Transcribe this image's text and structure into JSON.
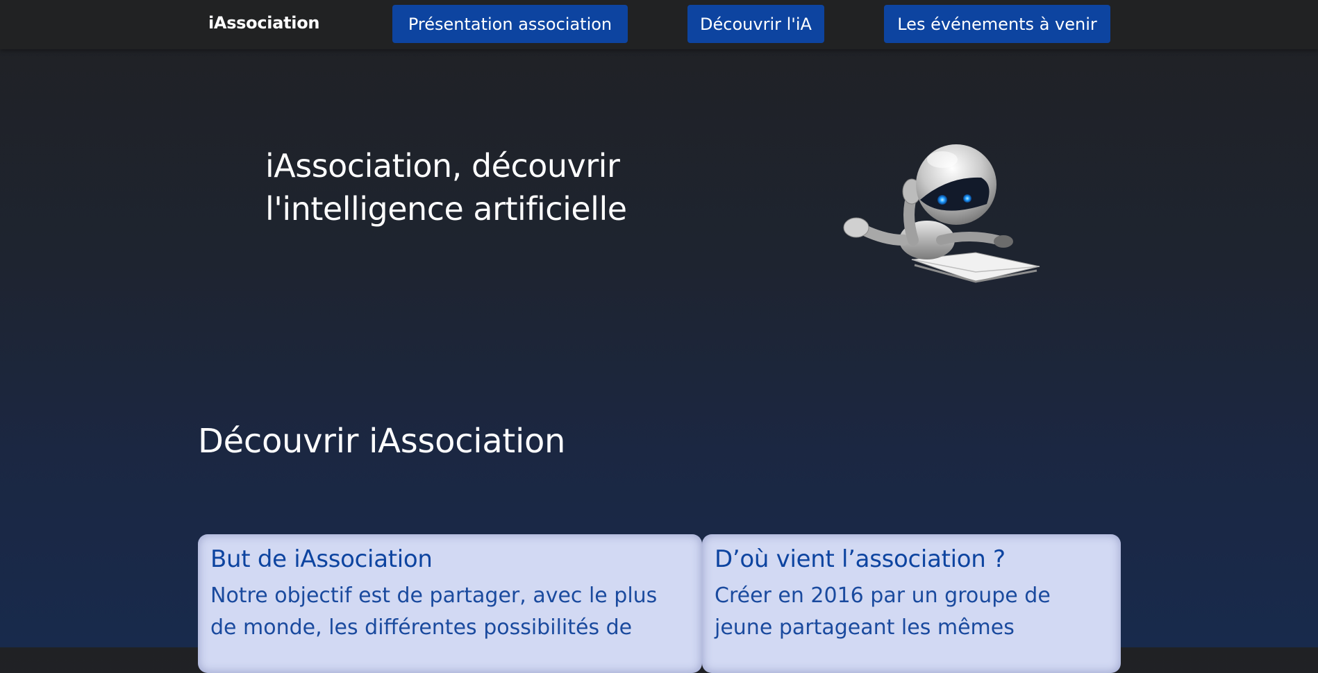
{
  "navbar": {
    "brand": "iAssociation",
    "links": [
      {
        "label": "Présentation association"
      },
      {
        "label": "Découvrir l'iA"
      },
      {
        "label": "Les événements à venir"
      }
    ]
  },
  "hero": {
    "title_line1": "iAssociation, découvrir",
    "title_line2": "l'intelligence artificielle",
    "image": "robot-reading-book"
  },
  "section": {
    "title": "Découvrir iAssociation"
  },
  "cards": [
    {
      "title": "But de iAssociation",
      "text": "Notre objectif est de partager, avec le plus de monde, les différentes possibilités de"
    },
    {
      "title": "D’où vient l’association ?",
      "text": "Créer en 2016 par un groupe de jeune partageant les mêmes"
    }
  ],
  "colors": {
    "nav_bg": "#212223",
    "button_bg": "#0d44a0",
    "card_bg": "#d2d9f3",
    "card_text": "#0d44a0",
    "page_bg_top": "#202124",
    "page_bg_bottom": "#182a4c"
  }
}
